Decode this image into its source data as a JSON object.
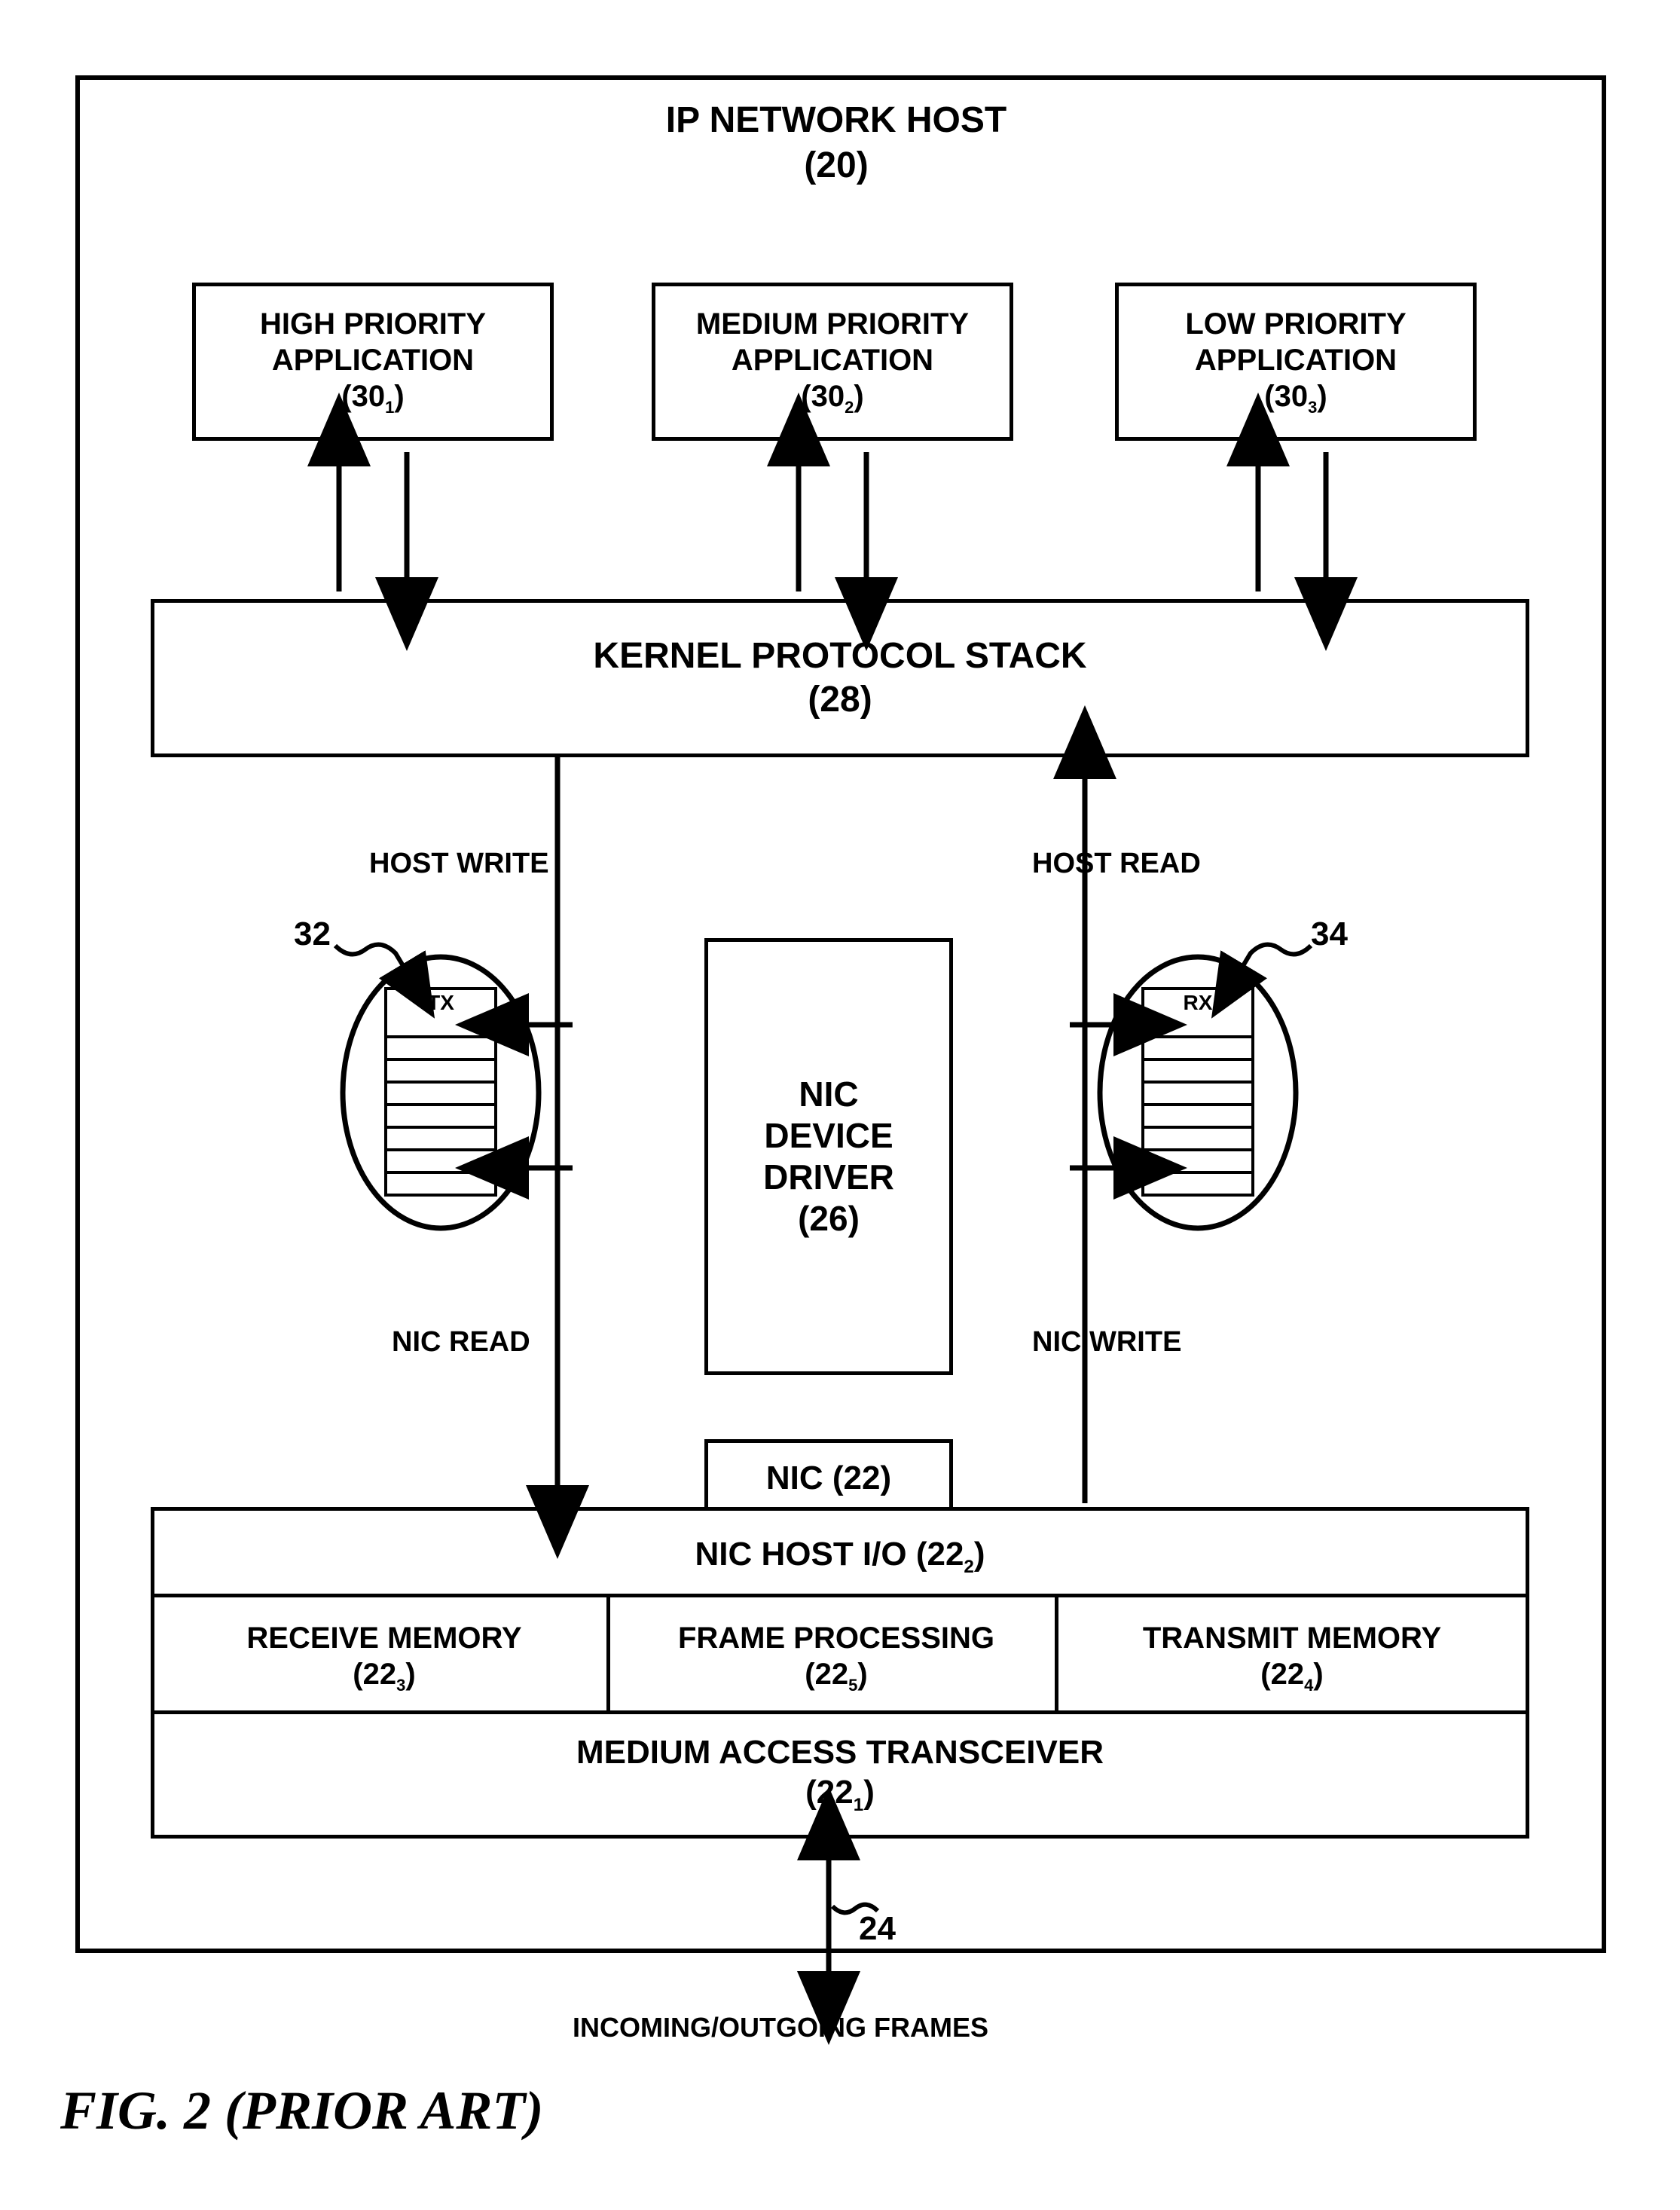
{
  "title": {
    "line1": "IP NETWORK HOST",
    "line2": "(20)"
  },
  "apps": [
    {
      "l1": "HIGH PRIORITY",
      "l2": "APPLICATION",
      "ref": "(30",
      "sub": "1",
      "refend": ")"
    },
    {
      "l1": "MEDIUM PRIORITY",
      "l2": "APPLICATION",
      "ref": "(30",
      "sub": "2",
      "refend": ")"
    },
    {
      "l1": "LOW PRIORITY",
      "l2": "APPLICATION",
      "ref": "(30",
      "sub": "3",
      "refend": ")"
    }
  ],
  "kernel": {
    "l1": "KERNEL PROTOCOL STACK",
    "l2": "(28)"
  },
  "nic_driver": {
    "l1": "NIC",
    "l2": "DEVICE",
    "l3": "DRIVER",
    "l4": "(26)"
  },
  "nic_tab": "NIC (22)",
  "nic_hostio": {
    "text": "NIC HOST I/O (22",
    "sub": "2",
    "end": ")"
  },
  "nic_row2": [
    {
      "l1": "RECEIVE MEMORY",
      "ref": "(22",
      "sub": "3",
      "end": ")"
    },
    {
      "l1": "FRAME PROCESSING",
      "ref": "(22",
      "sub": "5",
      "end": ")"
    },
    {
      "l1": "TRANSMIT MEMORY",
      "ref": "(22",
      "sub": "4",
      "end": ")"
    }
  ],
  "nic_mat": {
    "l1": "MEDIUM ACCESS TRANSCEIVER",
    "ref": "(22",
    "sub": "1",
    "end": ")"
  },
  "labels": {
    "host_write": "HOST WRITE",
    "host_read": "HOST READ",
    "nic_read": "NIC READ",
    "nic_write": "NIC WRITE",
    "incoming": "INCOMING/OUTGOING FRAMES"
  },
  "queue_tx": {
    "header": "TX",
    "ref": "32"
  },
  "queue_rx": {
    "header": "RX",
    "ref": "34"
  },
  "bottom_ref": "24",
  "figure_caption": "FIG. 2 (PRIOR ART)"
}
